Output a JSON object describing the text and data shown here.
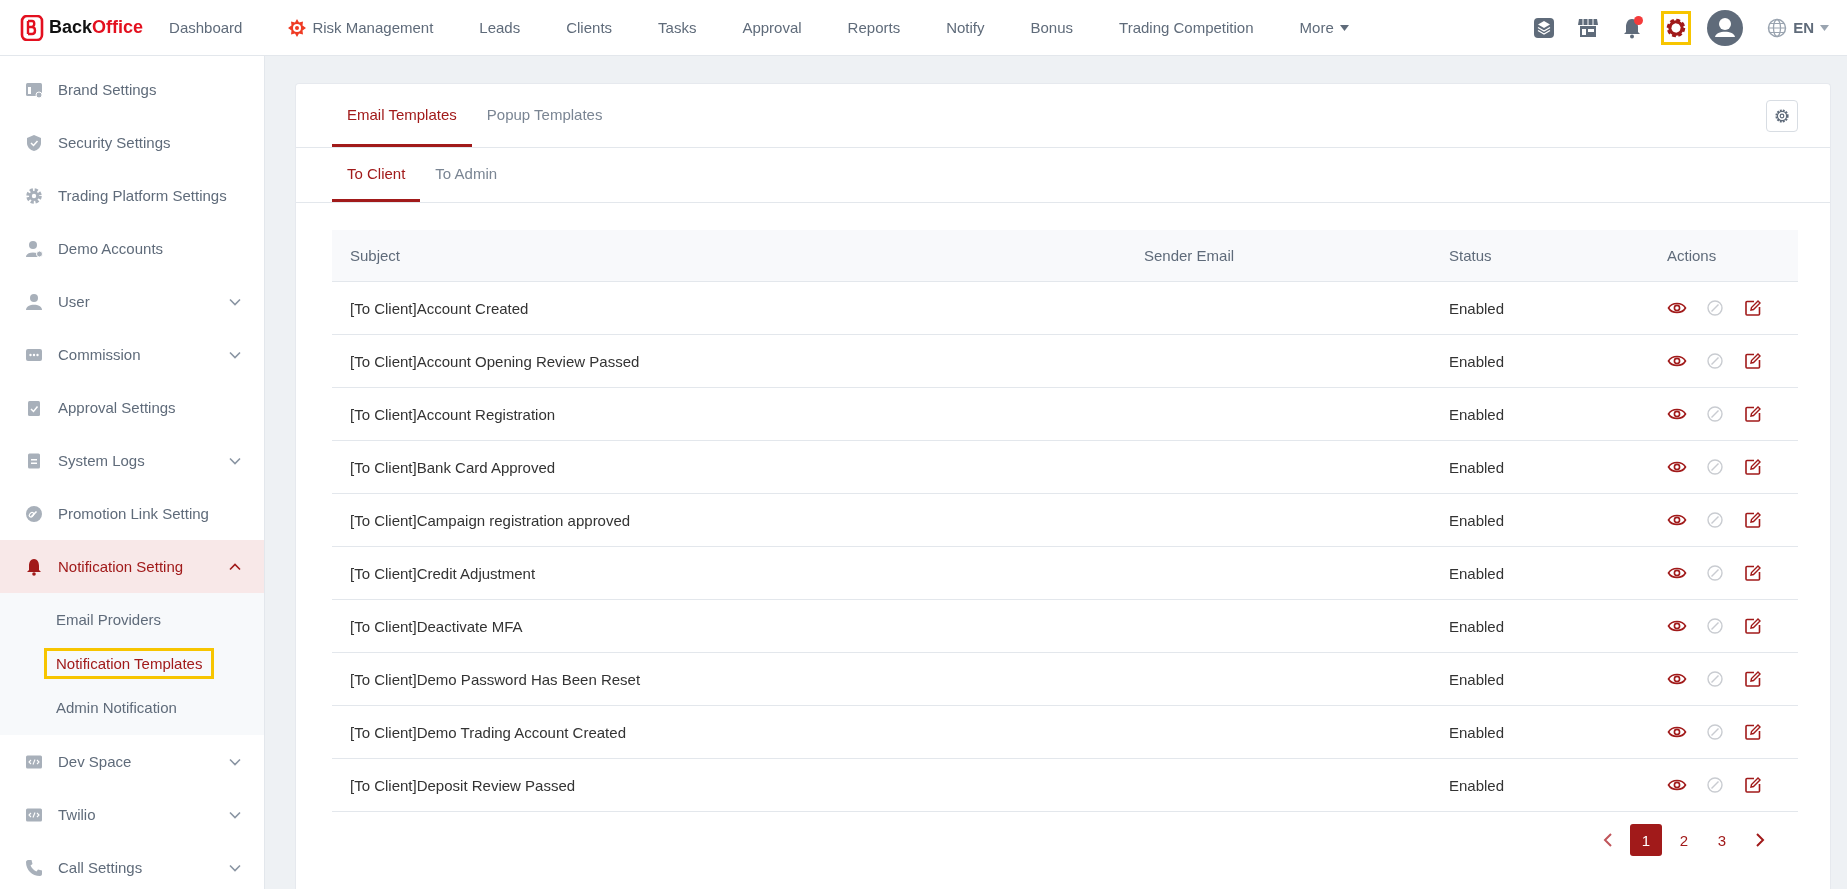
{
  "logo": {
    "first": "Back",
    "second": "Office"
  },
  "nav_items": [
    {
      "label": "Dashboard",
      "kind": "link"
    },
    {
      "label": "Risk Management",
      "kind": "alert"
    },
    {
      "label": "Leads",
      "kind": "link"
    },
    {
      "label": "Clients",
      "kind": "link"
    },
    {
      "label": "Tasks",
      "kind": "link"
    },
    {
      "label": "Approval",
      "kind": "link"
    },
    {
      "label": "Reports",
      "kind": "link"
    },
    {
      "label": "Notify",
      "kind": "link"
    },
    {
      "label": "Bonus",
      "kind": "link"
    },
    {
      "label": "Trading Competition",
      "kind": "link"
    },
    {
      "label": "More",
      "kind": "menu"
    }
  ],
  "toolbar_icons": [
    {
      "kind": "layers",
      "badge": false,
      "highlighted": false
    },
    {
      "kind": "store",
      "badge": false,
      "highlighted": false
    },
    {
      "kind": "bell",
      "badge": true,
      "highlighted": false
    },
    {
      "kind": "settings",
      "badge": false,
      "highlighted": true
    },
    {
      "kind": "avatar",
      "badge": false,
      "highlighted": false
    }
  ],
  "language": "EN",
  "sidebar": {
    "items": [
      {
        "label": "Brand Settings",
        "expandable": false,
        "selected": false
      },
      {
        "label": "Security Settings",
        "expandable": false,
        "selected": false
      },
      {
        "label": "Trading Platform Settings",
        "expandable": false,
        "selected": false
      },
      {
        "label": "Demo Accounts",
        "expandable": false,
        "selected": false
      },
      {
        "label": "User",
        "expandable": true,
        "selected": false
      },
      {
        "label": "Commission",
        "expandable": true,
        "selected": false
      },
      {
        "label": "Approval Settings",
        "expandable": false,
        "selected": false
      },
      {
        "label": "System Logs",
        "expandable": true,
        "selected": false
      },
      {
        "label": "Promotion Link Setting",
        "expandable": false,
        "selected": false
      },
      {
        "label": "Notification Setting",
        "expandable": true,
        "selected": true,
        "children": [
          {
            "label": "Email Providers",
            "selected": false,
            "highlighted": false
          },
          {
            "label": "Notification Templates",
            "selected": true,
            "highlighted": true
          },
          {
            "label": "Admin Notification",
            "selected": false,
            "highlighted": false
          }
        ]
      },
      {
        "label": "Dev Space",
        "expandable": true,
        "selected": false
      },
      {
        "label": "Twilio",
        "expandable": true,
        "selected": false
      },
      {
        "label": "Call Settings",
        "expandable": true,
        "selected": false
      }
    ]
  },
  "tabs": [
    {
      "label": "Email Templates",
      "selected": true
    },
    {
      "label": "Popup Templates",
      "selected": false
    }
  ],
  "subtabs": [
    {
      "label": "To Client",
      "selected": true
    },
    {
      "label": "To Admin",
      "selected": false
    }
  ],
  "table": {
    "columns": [
      "Subject",
      "Sender Email",
      "Status",
      "Actions"
    ],
    "actions": [
      {
        "kind": "view",
        "disabled": false
      },
      {
        "kind": "disable",
        "disabled": true
      },
      {
        "kind": "edit",
        "disabled": false
      }
    ],
    "rows": [
      {
        "subject": "[To Client]Account Created",
        "status": "Enabled"
      },
      {
        "subject": "[To Client]Account Opening Review Passed",
        "status": "Enabled"
      },
      {
        "subject": "[To Client]Account Registration",
        "status": "Enabled"
      },
      {
        "subject": "[To Client]Bank Card Approved",
        "status": "Enabled"
      },
      {
        "subject": "[To Client]Campaign registration approved",
        "status": "Enabled"
      },
      {
        "subject": "[To Client]Credit Adjustment",
        "status": "Enabled"
      },
      {
        "subject": "[To Client]Deactivate MFA",
        "status": "Enabled"
      },
      {
        "subject": "[To Client]Demo Password Has Been Reset",
        "status": "Enabled"
      },
      {
        "subject": "[To Client]Demo Trading Account Created",
        "status": "Enabled"
      },
      {
        "subject": "[To Client]Deposit Review Passed",
        "status": "Enabled"
      }
    ]
  },
  "pagination": {
    "pages": [
      {
        "label": "1",
        "selected": true
      },
      {
        "label": "2",
        "selected": false
      },
      {
        "label": "3",
        "selected": false
      }
    ]
  }
}
